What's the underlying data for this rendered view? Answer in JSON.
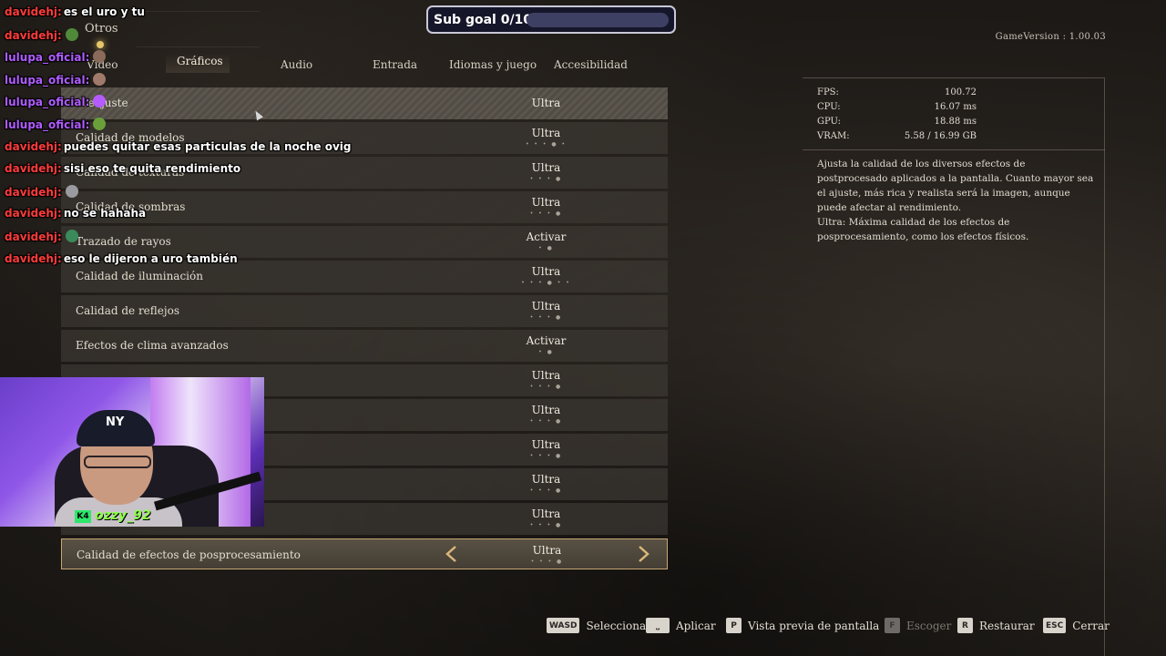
{
  "header": {
    "top_tab": "Otros",
    "tabs": [
      "Vídeo",
      "Gráficos",
      "Audio",
      "Entrada",
      "Idiomas y juego",
      "Accesibilidad"
    ],
    "active_tab": "Gráficos",
    "game_version": "GameVersion : 1.00.03"
  },
  "sub_goal": {
    "label": "Sub goal 0/10",
    "progress": 0
  },
  "settings": [
    {
      "label": "Preajuste",
      "value": "Ultra",
      "dots": ""
    },
    {
      "label": "Calidad de modelos",
      "value": "Ultra",
      "dots": "• • • ● •"
    },
    {
      "label": "Calidad de texturas",
      "value": "Ultra",
      "dots": "• • • ●"
    },
    {
      "label": "Calidad de sombras",
      "value": "Ultra",
      "dots": "• • • ●"
    },
    {
      "label": "Trazado de rayos",
      "value": "Activar",
      "dots": "• ●"
    },
    {
      "label": "Calidad de iluminación",
      "value": "Ultra",
      "dots": "• • • ● • •"
    },
    {
      "label": "Calidad de reflejos",
      "value": "Ultra",
      "dots": "• • • ●"
    },
    {
      "label": "Efectos de clima avanzados",
      "value": "Activar",
      "dots": "• ●"
    },
    {
      "label": "",
      "value": "Ultra",
      "dots": "• • • ●"
    },
    {
      "label": "",
      "value": "Ultra",
      "dots": "• • • ●"
    },
    {
      "label": "",
      "value": "Ultra",
      "dots": "• • • ●"
    },
    {
      "label": "",
      "value": "Ultra",
      "dots": "• • • ●"
    },
    {
      "label": "",
      "value": "Ultra",
      "dots": "• • • ●"
    },
    {
      "label": "Calidad de efectos de posprocesamiento",
      "value": "Ultra",
      "dots": "• • • ●"
    }
  ],
  "stats": [
    {
      "label": "FPS:",
      "value": "100.72"
    },
    {
      "label": "CPU:",
      "value": "16.07  ms"
    },
    {
      "label": "GPU:",
      "value": "18.88  ms"
    },
    {
      "label": "VRAM:",
      "value": "5.58  /  16.99  GB"
    }
  ],
  "description": "Ajusta la calidad de los diversos efectos de postprocesado aplicados a la pantalla. Cuanto mayor sea el ajuste, más rica y realista será la imagen, aunque puede afectar al rendimiento.\nUltra: Máxima calidad de los efectos de posprocesamiento, como los efectos físicos.",
  "controls": [
    {
      "key": "WASD",
      "label": "Seleccionar",
      "enabled": true
    },
    {
      "key": "⎵",
      "label": "Aplicar",
      "enabled": true
    },
    {
      "key": "P",
      "label": "Vista previa de pantalla",
      "enabled": true
    },
    {
      "key": "F",
      "label": "Escoger",
      "enabled": false
    },
    {
      "key": "R",
      "label": "Restaurar",
      "enabled": true
    },
    {
      "key": "ESC",
      "label": "Cerrar",
      "enabled": true
    }
  ],
  "chat": [
    {
      "user": "davidehj:",
      "color": "red",
      "msg": "es el uro y tu"
    },
    {
      "user": "davidehj:",
      "color": "red",
      "msg": "",
      "emote": "#4f8a3a"
    },
    {
      "user": "lulupa_oficial:",
      "color": "purple",
      "msg": "",
      "emote": "#8a6a5a"
    },
    {
      "user": "lulupa_oficial:",
      "color": "purple",
      "msg": "",
      "emote": "#a07a6a"
    },
    {
      "user": "lulupa_oficial:",
      "color": "purple",
      "msg": "",
      "emote": "#b45cff"
    },
    {
      "user": "lulupa_oficial:",
      "color": "purple",
      "msg": "",
      "emote": "#6aa03a"
    },
    {
      "user": "davidehj:",
      "color": "red",
      "msg": "puedes quitar esas particulas de la noche ovig"
    },
    {
      "user": "davidehj:",
      "color": "red",
      "msg": "sisi eso te quita rendimiento"
    },
    {
      "user": "davidehj:",
      "color": "red",
      "msg": "",
      "emote": "#9a9aa0"
    },
    {
      "user": "davidehj:",
      "color": "red",
      "msg": "no se hahaha"
    },
    {
      "user": "davidehj:",
      "color": "red",
      "msg": "",
      "emote": "#3a8a5a"
    },
    {
      "user": "davidehj:",
      "color": "red",
      "msg": "eso le dijeron a uro también"
    }
  ],
  "webcam": {
    "name": "ozzy_92",
    "badge": "K4",
    "cap_logo": "NY"
  },
  "colors": {
    "accent_border": "#c7a772",
    "subgoal_bg": "#15162a",
    "chat_red": "#ff3b3b",
    "chat_purple": "#b05cff"
  }
}
